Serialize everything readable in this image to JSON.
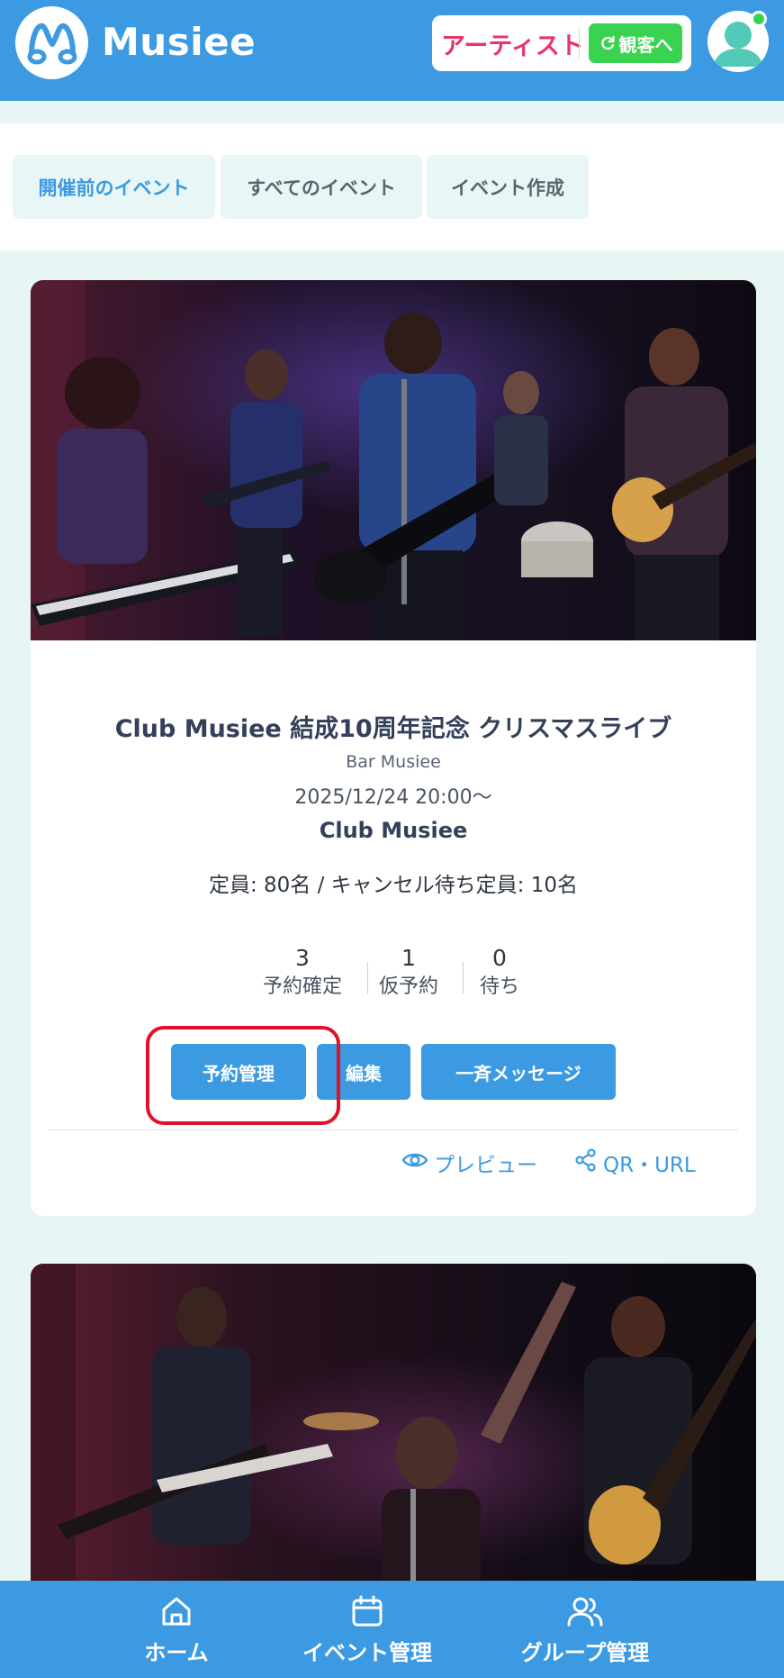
{
  "header": {
    "brand": "Musiee",
    "role_label": "アーティスト",
    "switch_label": "観客へ"
  },
  "tabs": [
    {
      "label": "開催前のイベント",
      "active": true
    },
    {
      "label": "すべてのイベント",
      "active": false
    },
    {
      "label": "イベント作成",
      "active": false
    }
  ],
  "events": [
    {
      "title": "Club Musiee 結成10周年記念 クリスマスライブ",
      "venue": "Bar Musiee",
      "datetime": "2025/12/24 20:00〜",
      "organizer": "Club Musiee",
      "capacity": "定員: 80名 / キャンセル待ち定員: 10名",
      "stats": [
        {
          "value": "3",
          "label": "予約確定"
        },
        {
          "value": "1",
          "label": "仮予約"
        },
        {
          "value": "0",
          "label": "待ち"
        }
      ],
      "actions": {
        "reservations": "予約管理",
        "edit": "編集",
        "broadcast": "一斉メッセージ"
      },
      "links": {
        "preview": "プレビュー",
        "share": "QR・URL"
      }
    }
  ],
  "bottom_nav": [
    {
      "label": "ホーム",
      "icon": "home-icon"
    },
    {
      "label": "イベント管理",
      "icon": "calendar-icon"
    },
    {
      "label": "グループ管理",
      "icon": "users-icon"
    }
  ],
  "colors": {
    "primary": "#3b9ae1",
    "background": "#e7f6f5",
    "switch_green": "#3ad34f",
    "artist_pink": "#e8366b",
    "highlight_red": "#e0112b"
  }
}
